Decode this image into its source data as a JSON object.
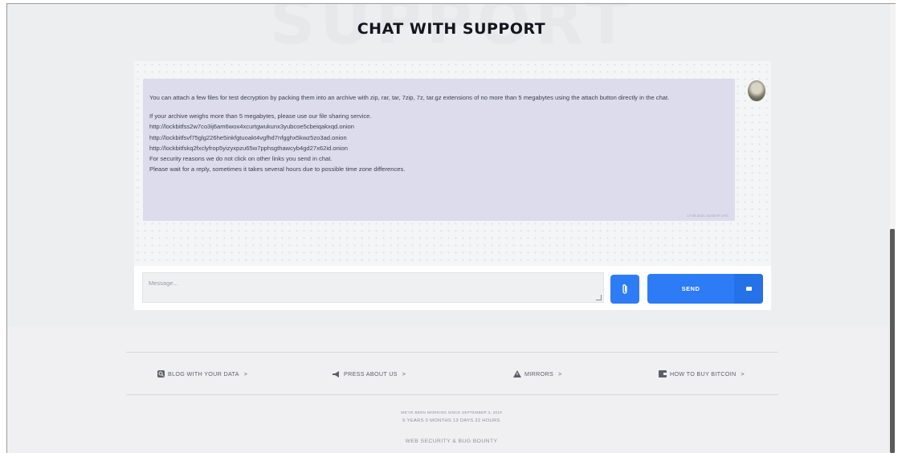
{
  "header": {
    "background_word": "SUPPORT",
    "title": "CHAT WITH SUPPORT"
  },
  "chat": {
    "message": {
      "paragraph1": "You can attach a few files for test decryption by packing them into an archive with zip, rar, tar, 7zip, 7z, tar.gz extensions of no more than 5 megabytes using the attach button directly in the chat.",
      "lines": [
        "If your archive weighs more than 5 megabytes, please use our file sharing service.",
        "http://lockbitfss2w7co3ij6am6wox4xcurtgwukunx3yubcoe5cbeiqakxqd.onion",
        "http://lockbitfsvf75glg226he5inkfgtuoakt4vgfhd7nfgghx5kwz5zo3ad.onion",
        "http://lockbitfskq2fxclyfrop5yizyxpzu65w7pphsgthawcyb4gd27x62id.onion",
        "For security reasons we do not click on other links you send in chat.",
        "Please wait for a reply, sometimes it takes several hours due to possible time zone differences."
      ],
      "timestamp": "17.09.2021 10:00:07 UTC"
    },
    "input": {
      "placeholder": "Message..."
    },
    "send_label": "SEND",
    "icons": {
      "attach": "paperclip-icon",
      "send": "message-icon",
      "avatar": "support-avatar"
    },
    "colors": {
      "accent": "#2d7cf6",
      "bubble": "#dcdcec"
    }
  },
  "footer": {
    "links": [
      {
        "icon": "search-icon",
        "label": "BLOG WITH YOUR DATA",
        "chevron": ">"
      },
      {
        "icon": "megaphone-icon",
        "label": "PRESS ABOUT US",
        "chevron": ">"
      },
      {
        "icon": "warning-icon",
        "label": "MIRRORS",
        "chevron": ">"
      },
      {
        "icon": "bitcoin-wallet-icon",
        "label": "HOW TO BUY BITCOIN",
        "chevron": ">"
      }
    ],
    "line1": "WE'VE BEEN WORKING SINCE SEPTEMBER 3, 2019",
    "line2": "6 YEARS 0 MONTHS 13 DAYS 22 HOURS",
    "line3": "WEB SECURITY & BUG BOUNTY"
  }
}
